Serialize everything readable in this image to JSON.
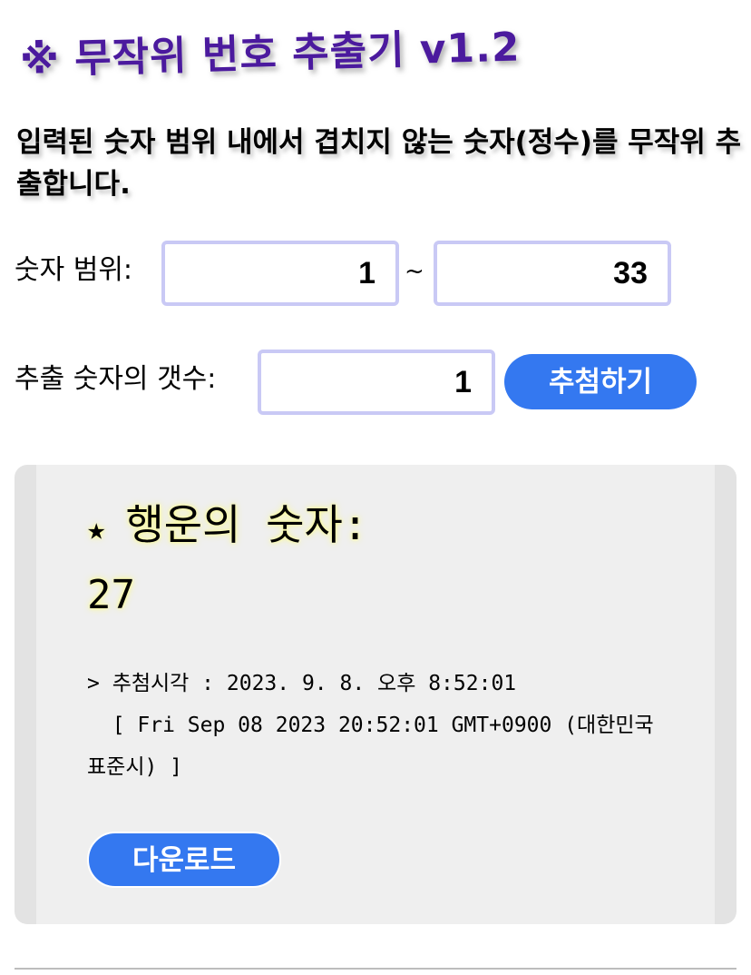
{
  "header": {
    "title": "※ 무작위 번호 추출기 v1.2"
  },
  "description": "입력된 숫자 범위 내에서 겹치지 않는 숫자(정수)를 무작위 추출합니다.",
  "form": {
    "range_label": "숫자 범위:",
    "range_min": "1",
    "range_separator": "~",
    "range_max": "33",
    "count_label": "추출 숫자의 갯수:",
    "count_value": "1",
    "draw_button_label": "추첨하기"
  },
  "result": {
    "star_icon": "★",
    "heading": "행운의 숫자:",
    "number": "27",
    "draw_time_text": "> 추첨시각 : 2023. 9. 8. 오후 8:52:01\n  [ Fri Sep 08 2023 20:52:01 GMT+0900 (대한민국 표준시) ]",
    "download_button_label": "다운로드"
  },
  "colors": {
    "title": "#4b1a9e",
    "button": "#3478f0",
    "input_border": "#c9c9f5",
    "panel_bg": "#efefef"
  }
}
